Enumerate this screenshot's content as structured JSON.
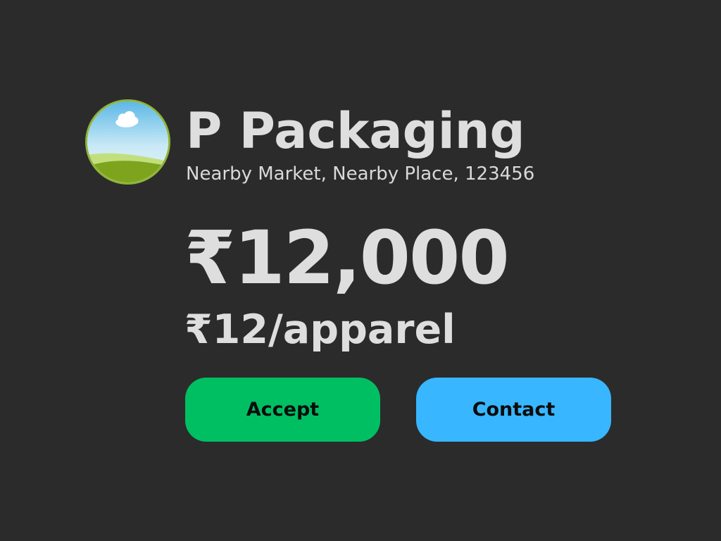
{
  "listing": {
    "avatar_icon": "landscape-image-icon",
    "name": "P Packaging",
    "address": "Nearby Market, Nearby Place, 123456",
    "total_price": "₹12,000",
    "unit_price": "₹12/apparel"
  },
  "actions": {
    "accept_label": "Accept",
    "contact_label": "Contact"
  },
  "colors": {
    "background": "#2b2b2b",
    "text": "#dedede",
    "accept": "#00bf63",
    "contact": "#38b6ff",
    "avatar_border": "#8fb43a"
  }
}
